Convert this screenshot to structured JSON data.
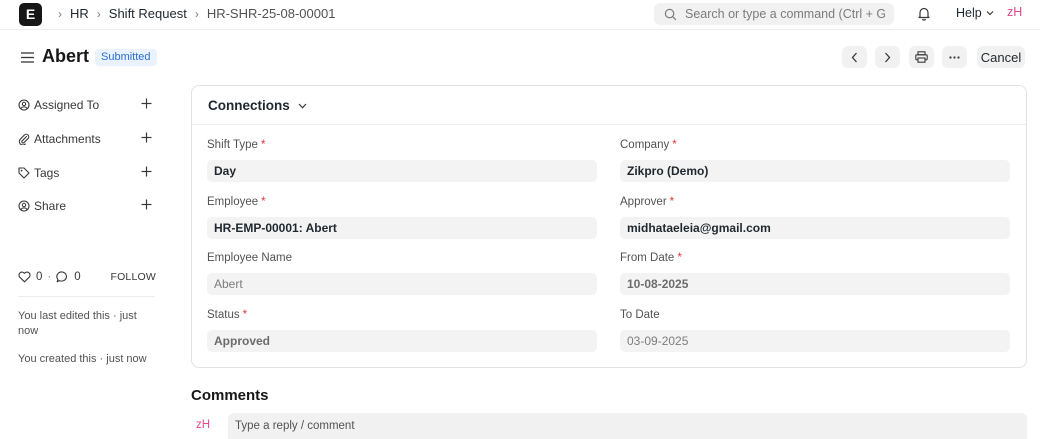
{
  "navbar": {
    "logo": "E",
    "breadcrumbs": [
      "HR",
      "Shift Request",
      "HR-SHR-25-08-00001"
    ],
    "search_placeholder": "Search or type a command (Ctrl + G)",
    "help_label": "Help",
    "user_initials": "zH"
  },
  "header": {
    "title": "Abert",
    "status": "Submitted",
    "cancel_label": "Cancel"
  },
  "sidebar": {
    "items": [
      {
        "label": "Assigned To",
        "icon": "assign-icon"
      },
      {
        "label": "Attachments",
        "icon": "paperclip-icon"
      },
      {
        "label": "Tags",
        "icon": "tag-icon"
      },
      {
        "label": "Share",
        "icon": "share-icon"
      }
    ],
    "likes_count": "0",
    "comments_count": "0",
    "follow_label": "FOLLOW",
    "activity": [
      "You last edited this · just now",
      "You created this · just now"
    ]
  },
  "form": {
    "section_title": "Connections",
    "fields": [
      {
        "label": "Shift Type",
        "required": true,
        "value": "Day"
      },
      {
        "label": "Company",
        "required": true,
        "value": "Zikpro (Demo)"
      },
      {
        "label": "Employee",
        "required": true,
        "value": "HR-EMP-00001: Abert"
      },
      {
        "label": "Approver",
        "required": true,
        "value": "midhataeleia@gmail.com"
      },
      {
        "label": "Employee Name",
        "required": false,
        "value": "Abert"
      },
      {
        "label": "From Date",
        "required": true,
        "value": "10-08-2025"
      },
      {
        "label": "Status",
        "required": true,
        "value": "Approved"
      },
      {
        "label": "To Date",
        "required": false,
        "value": "03-09-2025"
      }
    ]
  },
  "comments": {
    "title": "Comments",
    "avatar": "zH",
    "placeholder": "Type a reply / comment"
  },
  "colors": {
    "accent_pink": "#e0488b",
    "badge_blue": "#2b6fd1",
    "required_red": "#e03636"
  }
}
